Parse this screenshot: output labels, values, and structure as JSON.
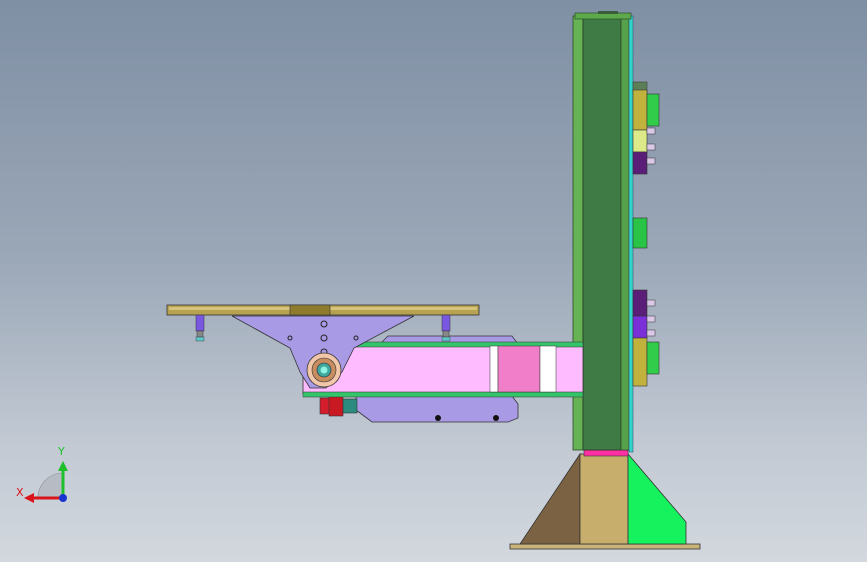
{
  "triad": {
    "x_label": "X",
    "y_label": "Y",
    "x_color": "#d9141a",
    "y_color": "#1fbf2b",
    "z_color": "#1a33d0"
  },
  "model": {
    "components": [
      "base-pedestal",
      "vertical-column",
      "column-mounted-blocks",
      "horizontal-arm",
      "arm-pivot-joint",
      "gripper-mount-plate",
      "top-rail",
      "motor-assembly"
    ],
    "colors": {
      "column": "#3f7b44",
      "column_frame": "#5daa4c",
      "base_left": "#7a6242",
      "base_mid": "#c8ae6c",
      "base_right": "#15f25e",
      "arm": "#ffbbff",
      "arm_accent": "#f57dc4",
      "mount_plate": "#a99ae6",
      "rail": "#b6a250"
    }
  }
}
